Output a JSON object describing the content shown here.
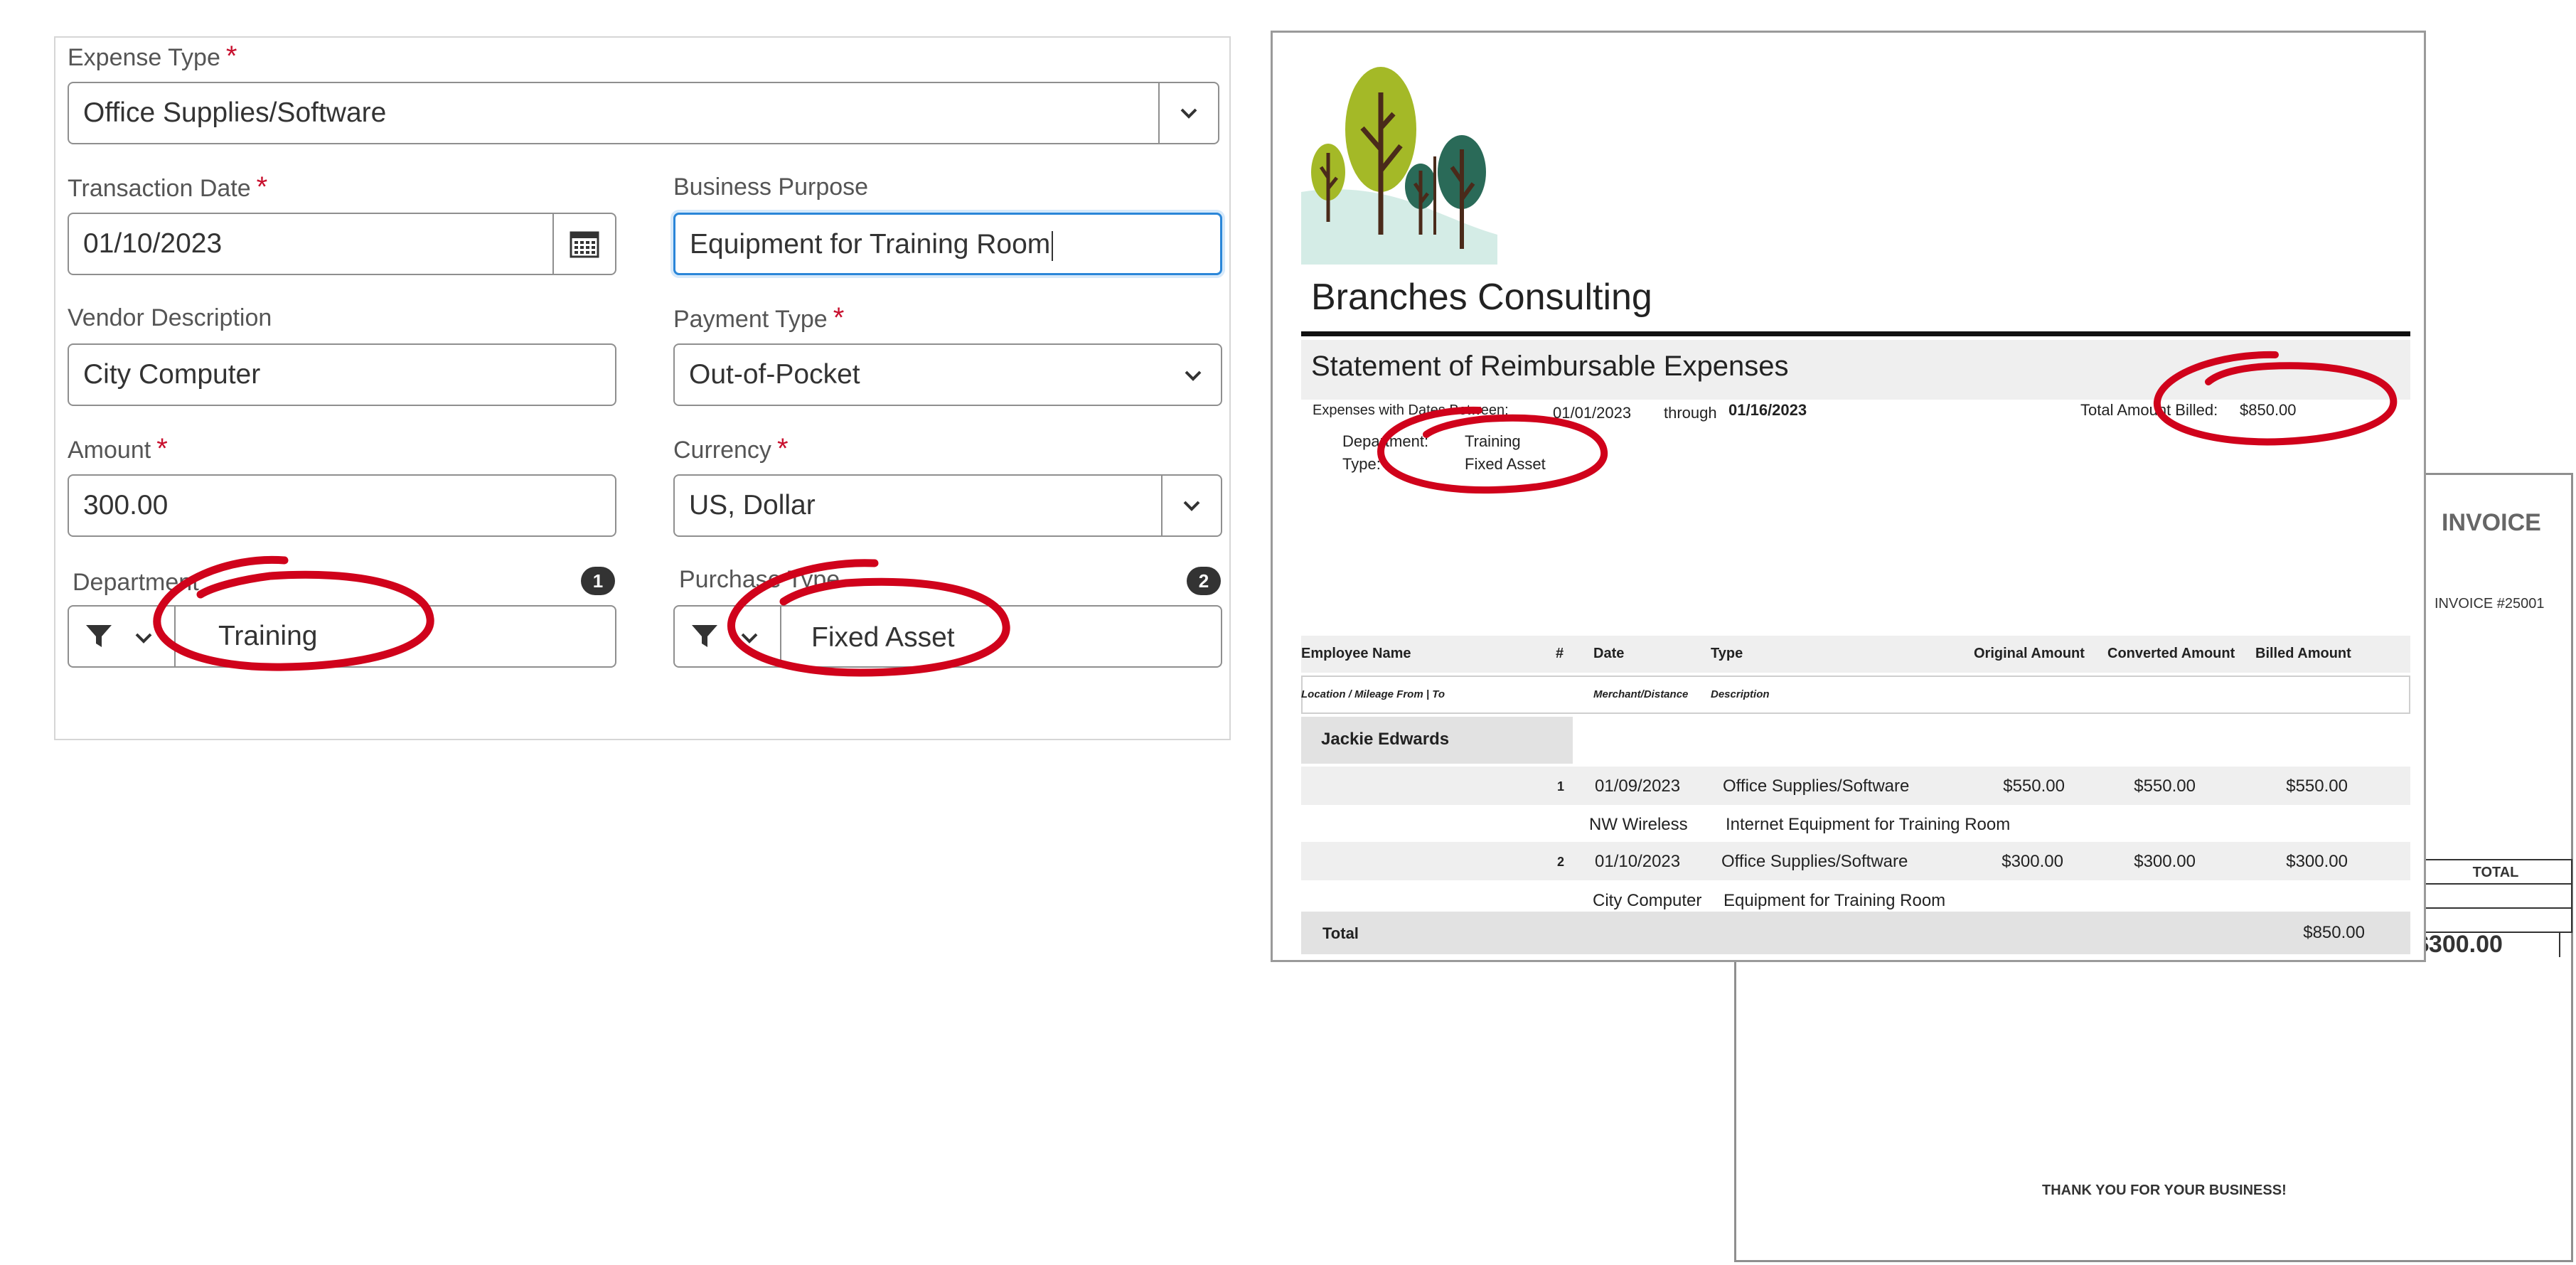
{
  "form": {
    "expense_type": {
      "label": "Expense Type",
      "required_mark": "*",
      "value": "Office Supplies/Software"
    },
    "transaction_date": {
      "label": "Transaction Date",
      "required_mark": "*",
      "value": "01/10/2023"
    },
    "business_purpose": {
      "label": "Business Purpose",
      "value": "Equipment for Training Room"
    },
    "vendor_description": {
      "label": "Vendor Description",
      "value": "City Computer"
    },
    "payment_type": {
      "label": "Payment Type",
      "required_mark": "*",
      "value": "Out-of-Pocket"
    },
    "amount": {
      "label": "Amount",
      "required_mark": "*",
      "value": "300.00"
    },
    "currency": {
      "label": "Currency",
      "required_mark": "*",
      "value": "US, Dollar"
    },
    "department": {
      "label": "Department",
      "badge": "1",
      "value": "Training"
    },
    "purchase_type": {
      "label": "Purchase Type",
      "badge": "2",
      "value": "Fixed Asset"
    }
  },
  "statement": {
    "company": "Branches Consulting",
    "title": "Statement of Reimbursable Expenses",
    "dates_label": "Expenses with Dates Between:",
    "date_from": "01/01/2023",
    "through_label": "through",
    "date_to": "01/16/2023",
    "total_billed_label": "Total Amount Billed:",
    "total_billed": "$850.00",
    "department_label": "Department:",
    "department_value": "Training",
    "type_label": "Type:",
    "type_value": "Fixed Asset",
    "columns": {
      "employee": "Employee Name",
      "num": "#",
      "date": "Date",
      "type": "Type",
      "original": "Original Amount",
      "converted": "Converted Amount",
      "billed": "Billed Amount"
    },
    "subheaders": {
      "location": "Location / Mileage From | To",
      "merchant": "Merchant/Distance",
      "description": "Description"
    },
    "employee": "Jackie Edwards",
    "rows": [
      {
        "num": "1",
        "date": "01/09/2023",
        "type": "Office Supplies/Software",
        "original": "$550.00",
        "converted": "$550.00",
        "billed": "$550.00",
        "merchant": "NW Wireless",
        "description": "Internet Equipment for Training Room"
      },
      {
        "num": "2",
        "date": "01/10/2023",
        "type": "Office Supplies/Software",
        "original": "$300.00",
        "converted": "$300.00",
        "billed": "$300.00",
        "merchant": "City Computer",
        "description": "Equipment for Training Room"
      }
    ],
    "total_label": "Total",
    "total_value": "$850.00"
  },
  "invoice": {
    "title": "INVOICE",
    "number": "INVOICE #25001",
    "total_header": "TOTAL",
    "grand_total": "$300.00",
    "thanks": "THANK YOU FOR YOUR BUSINESS!"
  },
  "colors": {
    "required": "#c8102e",
    "annotation": "#d0021b",
    "focus_border": "#2a86d8",
    "badge": "#333333",
    "band": "#efefef"
  }
}
